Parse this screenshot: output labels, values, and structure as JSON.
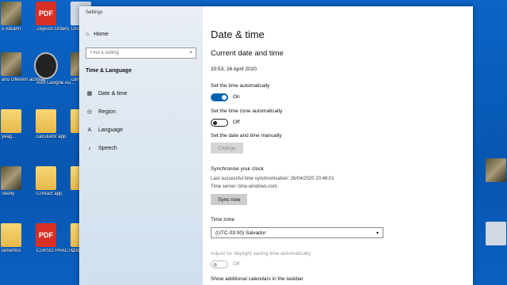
{
  "desktop": {
    "icons": [
      {
        "label": "o Abrahn",
        "kind": "photo"
      },
      {
        "label": "Zeyicon Orders",
        "kind": "pdf",
        "glyph": "PDF"
      },
      {
        "label": "Dro",
        "kind": "gray"
      },
      {
        "label": "aho Oflerent acontalt",
        "kind": "photo"
      },
      {
        "label": "Avril Lavigne Au...",
        "kind": "music"
      },
      {
        "label": "cam",
        "kind": "photo"
      },
      {
        "label": "yeag...",
        "kind": "folder"
      },
      {
        "label": "calculator app",
        "kind": "folder"
      },
      {
        "label": "",
        "kind": "folder"
      },
      {
        "label": "Skelly",
        "kind": "photo"
      },
      {
        "label": "Contact app",
        "kind": "folder"
      },
      {
        "label": "",
        "kind": "folder"
      },
      {
        "label": "lamentos",
        "kind": "folder"
      },
      {
        "label": "CURSO PRACTICO DE...",
        "kind": "pdf",
        "glyph": "PDF"
      },
      {
        "label": "O Gu PA",
        "kind": "folder"
      }
    ]
  },
  "window": {
    "title": "Settings",
    "controls": {
      "minimize": "—",
      "maximize": "☐",
      "close": "✕"
    }
  },
  "sidebar": {
    "home": "Home",
    "search_placeholder": "Find a setting",
    "section_title": "Time & Language",
    "items": [
      {
        "label": "Date & time",
        "icon": "calendar-icon"
      },
      {
        "label": "Region",
        "icon": "globe-icon"
      },
      {
        "label": "Language",
        "icon": "language-icon"
      },
      {
        "label": "Speech",
        "icon": "microphone-icon"
      }
    ]
  },
  "content": {
    "page_title": "Date & time",
    "section_title": "Current date and time",
    "current_datetime": "20:53, 26 April 2020",
    "set_time_auto": {
      "label": "Set the time automatically",
      "state": "On"
    },
    "set_timezone_auto": {
      "label": "Set the time zone automatically",
      "state": "Off"
    },
    "set_manually": {
      "label": "Set the date and time manually",
      "button": "Change"
    },
    "sync": {
      "title": "Synchronise your clock",
      "last_sync": "Last successful time synchronisation: 26/04/2020 20:48:01",
      "server": "Time server: time.windows.com",
      "button": "Sync now"
    },
    "timezone": {
      "label": "Time zone",
      "value": "(UTC-03:00) Salvador"
    },
    "dst": {
      "label": "Adjust for daylight saving time automatically",
      "state": "Off"
    },
    "additional_calendars": "Show additional calendars in the taskbar"
  },
  "colors": {
    "accent": "#0063b1",
    "desktop": "#0756b0"
  }
}
